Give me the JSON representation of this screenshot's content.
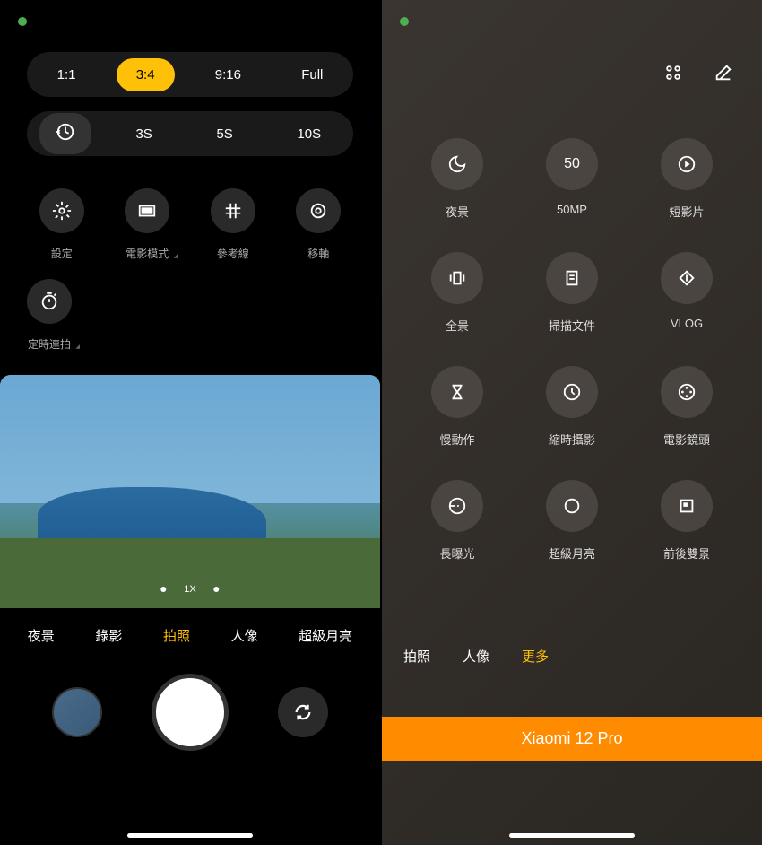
{
  "left": {
    "ratios": [
      "1:1",
      "3:4",
      "9:16",
      "Full"
    ],
    "ratioActive": 1,
    "timers": [
      "timer-icon",
      "3S",
      "5S",
      "10S"
    ],
    "timerActive": 0,
    "actions": [
      {
        "icon": "gear",
        "label": "設定",
        "arrow": false
      },
      {
        "icon": "movie",
        "label": "電影模式",
        "arrow": true
      },
      {
        "icon": "grid",
        "label": "參考線",
        "arrow": false
      },
      {
        "icon": "target",
        "label": "移軸",
        "arrow": false
      }
    ],
    "actions2": [
      {
        "icon": "timer",
        "label": "定時連拍",
        "arrow": true
      }
    ],
    "zoom": "1X",
    "modes": [
      "夜景",
      "錄影",
      "拍照",
      "人像",
      "超級月亮"
    ],
    "modeActive": 2
  },
  "right": {
    "grid": [
      {
        "icon": "moon",
        "label": "夜景"
      },
      {
        "icon": "50",
        "label": "50MP",
        "isText": true
      },
      {
        "icon": "play",
        "label": "短影片"
      },
      {
        "icon": "panorama",
        "label": "全景"
      },
      {
        "icon": "document",
        "label": "掃描文件"
      },
      {
        "icon": "vlog",
        "label": "VLOG"
      },
      {
        "icon": "hourglass",
        "label": "慢動作"
      },
      {
        "icon": "clock",
        "label": "縮時攝影"
      },
      {
        "icon": "dots",
        "label": "電影鏡頭"
      },
      {
        "icon": "exposure",
        "label": "長曝光"
      },
      {
        "icon": "circle",
        "label": "超級月亮"
      },
      {
        "icon": "dual",
        "label": "前後雙景"
      }
    ],
    "tabs": [
      "拍照",
      "人像",
      "更多"
    ],
    "tabActive": 2,
    "banner": "Xiaomi 12 Pro"
  }
}
